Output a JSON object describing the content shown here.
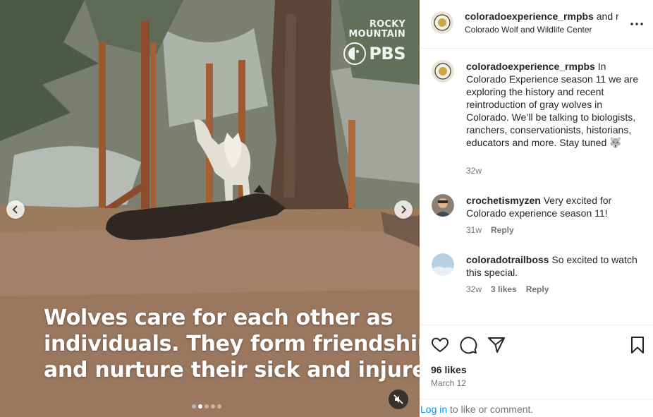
{
  "media": {
    "logo": {
      "line1": "ROCKY",
      "line2": "MOUNTAIN",
      "brand": "PBS"
    },
    "caption_lines": [
      "Wolves care for each other as",
      "individuals. They form friendships",
      "and nurture their sick and injured."
    ],
    "carousel": {
      "total": 5,
      "active_index": 1
    },
    "icons": {
      "prev": "chevron-left-icon",
      "next": "chevron-right-icon",
      "mute": "speaker-muted-icon"
    }
  },
  "post_header": {
    "username": "coloradoexperience_rmpbs",
    "and_text": "and r",
    "location": "Colorado Wolf and Wildlife Center"
  },
  "comments": [
    {
      "username": "coloradoexperience_rmpbs",
      "text": "In Colorado Experience season 11 we are exploring the history and recent reintroduction of gray wolves in Colorado. We’ll be talking to biologists, ranchers, conservationists, historians, educators and more. Stay tuned 🐺",
      "time": "32w"
    },
    {
      "username": "crochetismyzen",
      "text": "Very excited for Colorado experience season 11!",
      "time": "31w",
      "reply": "Reply"
    },
    {
      "username": "coloradotrailboss",
      "text": "So excited to watch this special.",
      "time": "32w",
      "likes": "3 likes",
      "reply": "Reply"
    }
  ],
  "actions": {
    "likes": "96 likes",
    "date": "March 12",
    "icons": [
      "heart-icon",
      "comment-icon",
      "share-icon",
      "bookmark-icon"
    ]
  },
  "login_prompt": {
    "link": "Log in",
    "rest": " to like or comment."
  },
  "colors": {
    "link": "#0095f6",
    "muted": "#737373",
    "text": "#262626"
  }
}
